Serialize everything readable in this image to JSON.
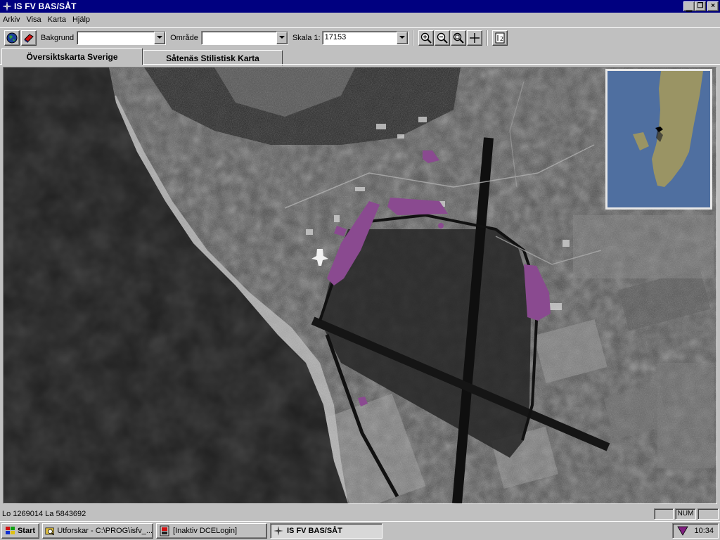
{
  "window": {
    "title": "IS FV BAS/SÅT",
    "controls": {
      "minimize": "_",
      "maximize": "❐",
      "close": "×"
    }
  },
  "menu": [
    {
      "label": "Arkiv"
    },
    {
      "label": "Visa"
    },
    {
      "label": "Karta"
    },
    {
      "label": "Hjälp"
    }
  ],
  "toolbar": {
    "bakgrund_label": "Bakgrund",
    "bakgrund_value": "",
    "omrade_label": "Område",
    "omrade_value": "",
    "skala_label": "Skala 1:",
    "skala_value": "17153",
    "icons": [
      "globe-icon",
      "layers-icon",
      "zoom-in-icon",
      "zoom-out-icon",
      "zoom-fit-icon",
      "pan-crosshair-icon",
      "scale-bar-icon"
    ]
  },
  "tabs": [
    {
      "label": "Översiktskarta Sverige",
      "active": true
    },
    {
      "label": "Såtenäs Stilistisk Karta",
      "active": false
    }
  ],
  "status": {
    "coordinates": "Lo 1269014 La 5843692",
    "num": "NUM"
  },
  "taskbar": {
    "start_label": "Start",
    "tasks": [
      {
        "label": "Utforskar - C:\\PROG\\isfv_...",
        "active": false
      },
      {
        "label": "[Inaktiv DCELogin]",
        "active": false
      },
      {
        "label": "IS FV BAS/SÅT",
        "active": true
      }
    ],
    "clock": "10:34"
  },
  "colors": {
    "title_bar": "#000080",
    "chrome": "#c0c0c0",
    "highlight_overlay": "#8a4a90",
    "overview_sea": "#4f6fa0",
    "overview_land": "#9a9464"
  }
}
